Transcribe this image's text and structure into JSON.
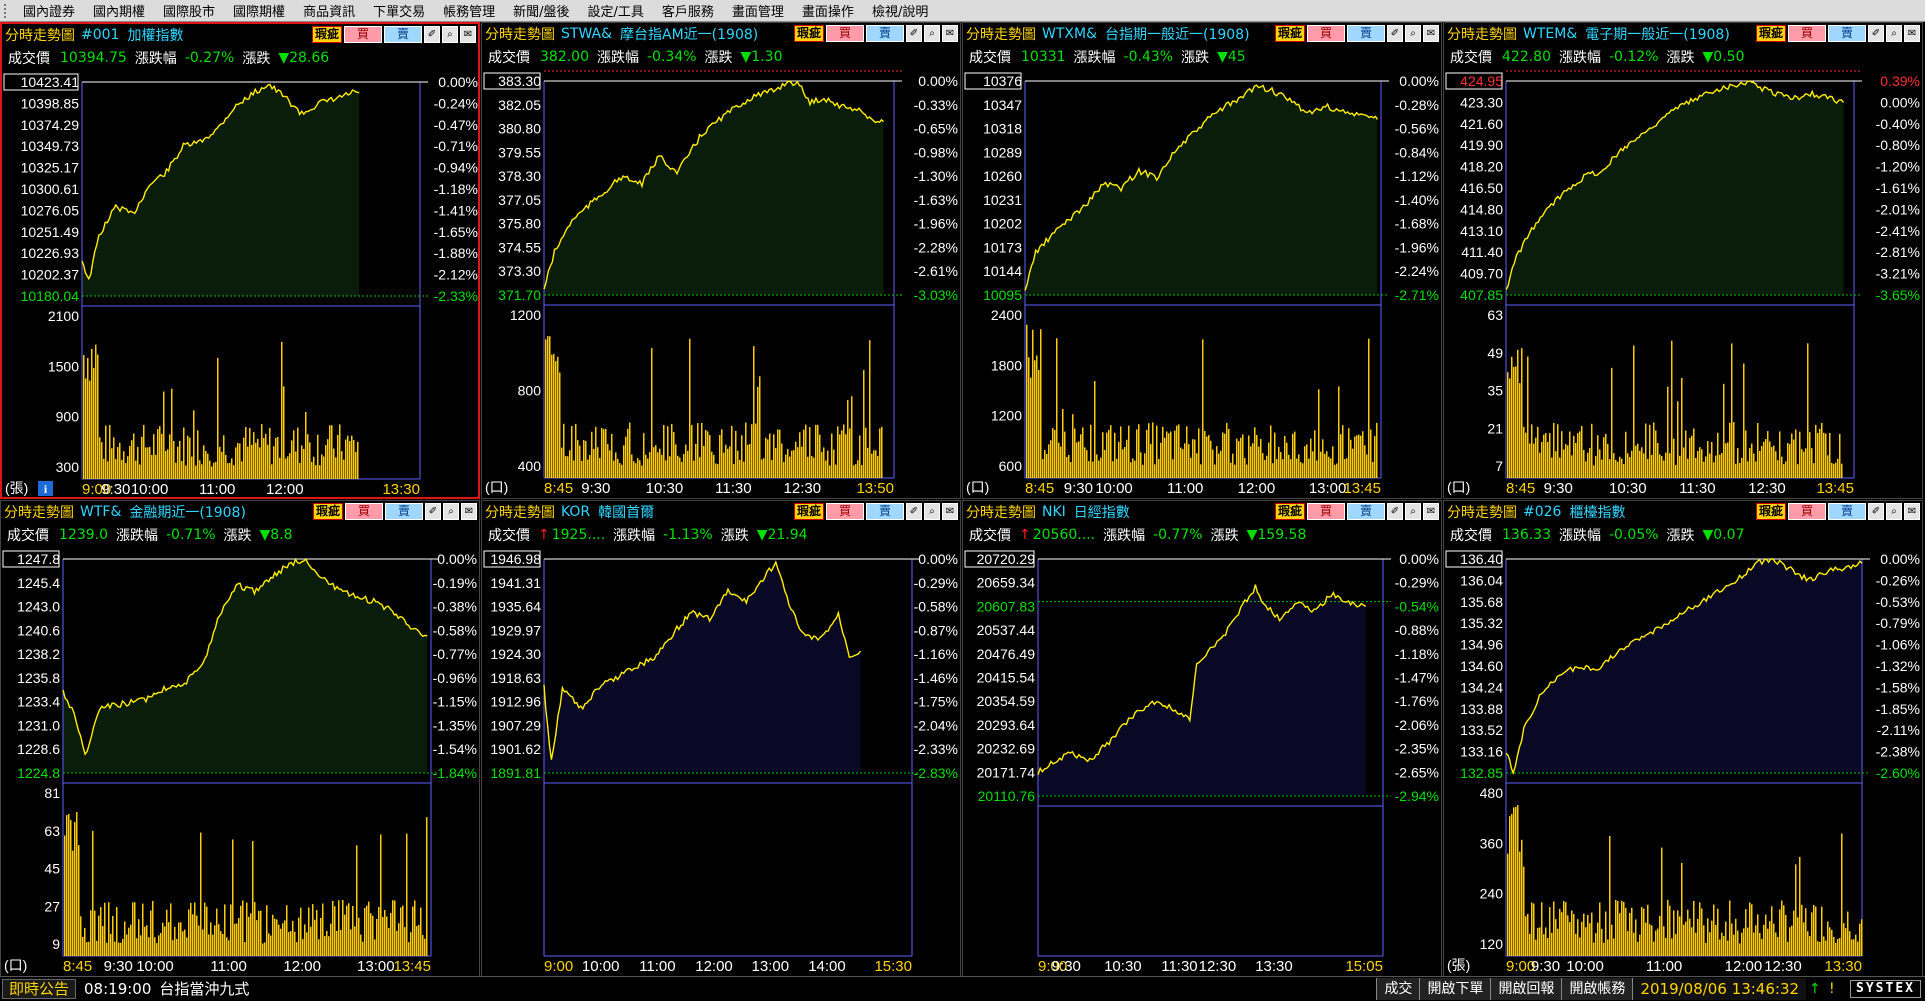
{
  "menu": [
    "國內證券",
    "國內期權",
    "國際股市",
    "國際期權",
    "商品資訊",
    "下單交易",
    "帳務管理",
    "新聞/盤後",
    "設定/工具",
    "客戶服務",
    "畫面管理",
    "畫面操作",
    "檢視/說明"
  ],
  "panel_header": {
    "type_label": "分時走勢圖",
    "btn_hl": "瑕疵",
    "btn_buy": "買",
    "btn_sell": "賣",
    "btn_i1": "✐",
    "btn_i2": "⌕",
    "btn_i3": "✉"
  },
  "quote_labels": {
    "price": "成交價",
    "pct": "漲跌幅",
    "chg": "漲跌"
  },
  "colors": {
    "up": "#ff2020",
    "down": "#00e000",
    "price": "#ffd400",
    "ref": "#ffffff",
    "hi": "#ff2020",
    "lo": "#00e000",
    "volume": "#ffd400"
  },
  "panels": [
    {
      "code": "#001",
      "name": "加權指數",
      "arrow": "",
      "price": "10394.75",
      "pct": "-0.27%",
      "chg": "▼28.66",
      "active": true,
      "price_axis": [
        "10423.41",
        "10398.85",
        "10374.29",
        "10349.73",
        "10325.17",
        "10300.61",
        "10276.05",
        "10251.49",
        "10226.93",
        "10202.37",
        "10180.04"
      ],
      "pct_axis": [
        "0.00%",
        "-0.24%",
        "-0.47%",
        "-0.71%",
        "-0.94%",
        "-1.18%",
        "-1.41%",
        "-1.65%",
        "-1.88%",
        "-2.12%",
        "-2.33%"
      ],
      "vol_axis": [
        "2100",
        "1500",
        "900",
        "300"
      ],
      "vol_unit": "(張)",
      "vol_max": 2100,
      "info_icon": true,
      "time_axis": [
        "9:00",
        "9:30",
        "10:00",
        "11:00",
        "12:00",
        "13:30"
      ],
      "time_frac": [
        0,
        0.1,
        0.2,
        0.4,
        0.6,
        1
      ],
      "profile": [
        [
          0,
          0.83
        ],
        [
          0.02,
          0.93
        ],
        [
          0.05,
          0.72
        ],
        [
          0.1,
          0.58
        ],
        [
          0.15,
          0.62
        ],
        [
          0.2,
          0.48
        ],
        [
          0.25,
          0.42
        ],
        [
          0.3,
          0.3
        ],
        [
          0.35,
          0.28
        ],
        [
          0.4,
          0.22
        ],
        [
          0.45,
          0.12
        ],
        [
          0.5,
          0.06
        ],
        [
          0.55,
          0.01
        ],
        [
          0.6,
          0.07
        ],
        [
          0.65,
          0.15
        ],
        [
          0.7,
          0.1
        ],
        [
          0.75,
          0.08
        ],
        [
          0.8,
          0.05
        ],
        [
          0.82,
          0.05
        ]
      ],
      "end_frac": 0.82,
      "hi_frac": 0.55,
      "ref_frac": 0,
      "mid_line": null,
      "show_mid_label": false,
      "mid_label": ""
    },
    {
      "code": "STWA&",
      "name": "摩台指AM近一(1908)",
      "arrow": "",
      "price": "382.00",
      "pct": "-0.34%",
      "chg": "▼1.30",
      "active": false,
      "price_axis": [
        "383.30",
        "382.05",
        "380.80",
        "379.55",
        "378.30",
        "377.05",
        "375.80",
        "374.55",
        "373.30",
        "371.70"
      ],
      "pct_axis": [
        "0.00%",
        "-0.33%",
        "-0.65%",
        "-0.98%",
        "-1.30%",
        "-1.63%",
        "-1.96%",
        "-2.28%",
        "-2.61%",
        "-3.03%"
      ],
      "vol_axis": [
        "1200",
        "800",
        "400"
      ],
      "vol_unit": "(口)",
      "vol_max": 1400,
      "info_icon": false,
      "time_axis": [
        "8:45",
        "9:30",
        "10:30",
        "11:30",
        "12:30",
        "13:50"
      ],
      "time_frac": [
        0,
        0.148,
        0.344,
        0.541,
        0.738,
        1
      ],
      "profile": [
        [
          0,
          0.97
        ],
        [
          0.03,
          0.8
        ],
        [
          0.08,
          0.65
        ],
        [
          0.15,
          0.55
        ],
        [
          0.22,
          0.45
        ],
        [
          0.28,
          0.48
        ],
        [
          0.33,
          0.35
        ],
        [
          0.38,
          0.43
        ],
        [
          0.45,
          0.25
        ],
        [
          0.5,
          0.18
        ],
        [
          0.55,
          0.12
        ],
        [
          0.6,
          0.07
        ],
        [
          0.65,
          0.05
        ],
        [
          0.7,
          0
        ],
        [
          0.73,
          0.02
        ],
        [
          0.76,
          0.1
        ],
        [
          0.8,
          0.08
        ],
        [
          0.85,
          0.12
        ],
        [
          0.9,
          0.13
        ],
        [
          0.93,
          0.18
        ],
        [
          0.97,
          0.19
        ]
      ],
      "end_frac": 0.97,
      "hi_frac": 0.7,
      "ref_frac": 0.08,
      "mid_line": null,
      "show_mid_label": false,
      "mid_label": ""
    },
    {
      "code": "WTXM&",
      "name": "台指期一般近一(1908)",
      "arrow": "",
      "price": "10331",
      "pct": "-0.43%",
      "chg": "▼45",
      "active": false,
      "price_axis": [
        "10376",
        "10347",
        "10318",
        "10289",
        "10260",
        "10231",
        "10202",
        "10173",
        "10144",
        "10095"
      ],
      "pct_axis": [
        "0.00%",
        "-0.28%",
        "-0.56%",
        "-0.84%",
        "-1.12%",
        "-1.40%",
        "-1.68%",
        "-1.96%",
        "-2.24%",
        "-2.71%"
      ],
      "vol_axis": [
        "2400",
        "1800",
        "1200",
        "600"
      ],
      "vol_unit": "(口)",
      "vol_max": 2600,
      "info_icon": false,
      "time_axis": [
        "8:45",
        "9:30",
        "10:00",
        "11:00",
        "12:00",
        "13:00",
        "13:45"
      ],
      "time_frac": [
        0,
        0.15,
        0.25,
        0.45,
        0.65,
        0.85,
        1
      ],
      "profile": [
        [
          0,
          0.98
        ],
        [
          0.03,
          0.8
        ],
        [
          0.1,
          0.68
        ],
        [
          0.17,
          0.58
        ],
        [
          0.22,
          0.48
        ],
        [
          0.27,
          0.5
        ],
        [
          0.32,
          0.42
        ],
        [
          0.37,
          0.45
        ],
        [
          0.42,
          0.33
        ],
        [
          0.47,
          0.25
        ],
        [
          0.52,
          0.17
        ],
        [
          0.56,
          0.12
        ],
        [
          0.6,
          0.09
        ],
        [
          0.65,
          0.02
        ],
        [
          0.7,
          0.05
        ],
        [
          0.75,
          0.1
        ],
        [
          0.8,
          0.15
        ],
        [
          0.85,
          0.12
        ],
        [
          0.9,
          0.15
        ],
        [
          0.95,
          0.16
        ],
        [
          0.99,
          0.18
        ]
      ],
      "end_frac": 0.99,
      "hi_frac": 0.65,
      "ref_frac": 0.05,
      "mid_line": null,
      "show_mid_label": false,
      "mid_label": ""
    },
    {
      "code": "WTEM&",
      "name": "電子期一般近一(1908)",
      "arrow": "",
      "price": "422.80",
      "pct": "-0.12%",
      "chg": "▼0.50",
      "active": false,
      "price_axis": [
        "424.95",
        "423.30",
        "421.60",
        "419.90",
        "418.20",
        "416.50",
        "414.80",
        "413.10",
        "411.40",
        "409.70",
        "407.85"
      ],
      "pct_axis": [
        "0.39%",
        "0.00%",
        "-0.40%",
        "-0.80%",
        "-1.20%",
        "-1.61%",
        "-2.01%",
        "-2.41%",
        "-2.81%",
        "-3.21%",
        "-3.65%"
      ],
      "vol_axis": [
        "63",
        "49",
        "35",
        "21",
        "7"
      ],
      "vol_unit": "(口)",
      "vol_max": 70,
      "info_icon": false,
      "time_axis": [
        "8:45",
        "9:30",
        "10:30",
        "11:30",
        "12:30",
        "13:45"
      ],
      "time_frac": [
        0,
        0.15,
        0.35,
        0.55,
        0.75,
        1
      ],
      "profile": [
        [
          0,
          0.98
        ],
        [
          0.03,
          0.82
        ],
        [
          0.08,
          0.68
        ],
        [
          0.13,
          0.58
        ],
        [
          0.18,
          0.5
        ],
        [
          0.23,
          0.44
        ],
        [
          0.28,
          0.42
        ],
        [
          0.33,
          0.32
        ],
        [
          0.4,
          0.24
        ],
        [
          0.45,
          0.17
        ],
        [
          0.5,
          0.12
        ],
        [
          0.55,
          0.08
        ],
        [
          0.6,
          0.04
        ],
        [
          0.65,
          0.02
        ],
        [
          0.7,
          0
        ],
        [
          0.73,
          0.03
        ],
        [
          0.78,
          0.06
        ],
        [
          0.83,
          0.08
        ],
        [
          0.88,
          0.06
        ],
        [
          0.93,
          0.08
        ],
        [
          0.97,
          0.1
        ]
      ],
      "end_frac": 0.97,
      "hi_frac": 0.7,
      "ref_frac": 0.087,
      "mid_line": null,
      "show_mid_label": false,
      "mid_label": ""
    },
    {
      "code": "WTF&",
      "name": "金融期近一(1908)",
      "arrow": "",
      "price": "1239.0",
      "pct": "-0.71%",
      "chg": "▼8.8",
      "active": false,
      "price_axis": [
        "1247.8",
        "1245.4",
        "1243.0",
        "1240.6",
        "1238.2",
        "1235.8",
        "1233.4",
        "1231.0",
        "1228.6",
        "1224.8"
      ],
      "pct_axis": [
        "0.00%",
        "-0.19%",
        "-0.38%",
        "-0.58%",
        "-0.77%",
        "-0.96%",
        "-1.15%",
        "-1.35%",
        "-1.54%",
        "-1.84%"
      ],
      "vol_axis": [
        "81",
        "63",
        "45",
        "27",
        "9"
      ],
      "vol_unit": "(口)",
      "vol_max": 90,
      "info_icon": false,
      "time_axis": [
        "8:45",
        "9:30",
        "10:00",
        "11:00",
        "12:00",
        "13:00",
        "13:45"
      ],
      "time_frac": [
        0,
        0.15,
        0.25,
        0.45,
        0.65,
        0.85,
        1
      ],
      "profile": [
        [
          0,
          0.62
        ],
        [
          0.03,
          0.72
        ],
        [
          0.06,
          0.92
        ],
        [
          0.1,
          0.7
        ],
        [
          0.15,
          0.68
        ],
        [
          0.22,
          0.66
        ],
        [
          0.28,
          0.6
        ],
        [
          0.33,
          0.58
        ],
        [
          0.38,
          0.5
        ],
        [
          0.42,
          0.28
        ],
        [
          0.47,
          0.12
        ],
        [
          0.52,
          0.15
        ],
        [
          0.57,
          0.08
        ],
        [
          0.62,
          0.02
        ],
        [
          0.66,
          0
        ],
        [
          0.7,
          0.08
        ],
        [
          0.75,
          0.15
        ],
        [
          0.8,
          0.18
        ],
        [
          0.85,
          0.2
        ],
        [
          0.9,
          0.25
        ],
        [
          0.95,
          0.32
        ],
        [
          0.99,
          0.36
        ]
      ],
      "end_frac": 0.99,
      "hi_frac": 0.66,
      "ref_frac": 0,
      "mid_line": null,
      "show_mid_label": false,
      "mid_label": ""
    },
    {
      "code": "KOR",
      "name": "韓國首爾",
      "arrow": "↑",
      "price": "1925....",
      "pct": "-1.13%",
      "chg": "▼21.94",
      "active": false,
      "price_axis": [
        "1946.98",
        "1941.31",
        "1935.64",
        "1929.97",
        "1924.30",
        "1918.63",
        "1912.96",
        "1907.29",
        "1901.62",
        "1891.81"
      ],
      "pct_axis": [
        "0.00%",
        "-0.29%",
        "-0.58%",
        "-0.87%",
        "-1.16%",
        "-1.46%",
        "-1.75%",
        "-2.04%",
        "-2.33%",
        "-2.83%"
      ],
      "vol_axis": [],
      "vol_unit": "",
      "vol_max": 0,
      "info_icon": false,
      "time_axis": [
        "9:00",
        "10:00",
        "11:00",
        "12:00",
        "13:00",
        "14:00",
        "15:30"
      ],
      "time_frac": [
        0,
        0.154,
        0.308,
        0.462,
        0.615,
        0.769,
        1
      ],
      "profile": [
        [
          0,
          0.6
        ],
        [
          0.02,
          0.95
        ],
        [
          0.05,
          0.6
        ],
        [
          0.1,
          0.7
        ],
        [
          0.15,
          0.6
        ],
        [
          0.2,
          0.55
        ],
        [
          0.25,
          0.5
        ],
        [
          0.3,
          0.46
        ],
        [
          0.35,
          0.35
        ],
        [
          0.4,
          0.25
        ],
        [
          0.45,
          0.28
        ],
        [
          0.5,
          0.15
        ],
        [
          0.55,
          0.2
        ],
        [
          0.6,
          0.08
        ],
        [
          0.63,
          0.02
        ],
        [
          0.66,
          0.18
        ],
        [
          0.7,
          0.35
        ],
        [
          0.75,
          0.38
        ],
        [
          0.8,
          0.26
        ],
        [
          0.83,
          0.45
        ],
        [
          0.86,
          0.43
        ]
      ],
      "end_frac": 0.86,
      "hi_frac": 0.63,
      "ref_frac": 0,
      "mid_line": null,
      "show_mid_label": false,
      "mid_label": ""
    },
    {
      "code": "NKI",
      "name": "日經指數",
      "arrow": "↑",
      "price": "20560....",
      "pct": "-0.77%",
      "chg": "▼159.58",
      "active": false,
      "price_axis": [
        "20720.29",
        "20659.34",
        "20607.83",
        "20537.44",
        "20476.49",
        "20415.54",
        "20354.59",
        "20293.64",
        "20232.69",
        "20171.74",
        "20110.76"
      ],
      "pct_axis": [
        "0.00%",
        "-0.29%",
        "-0.54%",
        "-0.88%",
        "-1.18%",
        "-1.47%",
        "-1.76%",
        "-2.06%",
        "-2.35%",
        "-2.65%",
        "-2.94%"
      ],
      "vol_axis": [],
      "vol_unit": "",
      "vol_max": 0,
      "info_icon": false,
      "time_axis": [
        "9:00",
        "9:30",
        "10:30",
        "11:30",
        "12:30",
        "13:30",
        "15:05"
      ],
      "time_frac": [
        0,
        0.082,
        0.246,
        0.41,
        0.52,
        0.684,
        1
      ],
      "profile": [
        [
          0,
          0.9
        ],
        [
          0.05,
          0.85
        ],
        [
          0.1,
          0.82
        ],
        [
          0.15,
          0.85
        ],
        [
          0.2,
          0.78
        ],
        [
          0.25,
          0.7
        ],
        [
          0.3,
          0.63
        ],
        [
          0.35,
          0.6
        ],
        [
          0.41,
          0.65
        ],
        [
          0.44,
          0.68
        ],
        [
          0.46,
          0.45
        ],
        [
          0.5,
          0.38
        ],
        [
          0.55,
          0.3
        ],
        [
          0.6,
          0.18
        ],
        [
          0.63,
          0.12
        ],
        [
          0.66,
          0.2
        ],
        [
          0.7,
          0.25
        ],
        [
          0.75,
          0.18
        ],
        [
          0.8,
          0.22
        ],
        [
          0.85,
          0.15
        ],
        [
          0.9,
          0.18
        ],
        [
          0.95,
          0.2
        ]
      ],
      "end_frac": 0.95,
      "hi_frac": 0,
      "ref_frac": 0,
      "mid_line": 0.18,
      "show_mid_label": true,
      "mid_label": "20607.83"
    },
    {
      "code": "#026",
      "name": "櫃檯指數",
      "arrow": "",
      "price": "136.33",
      "pct": "-0.05%",
      "chg": "▼0.07",
      "active": false,
      "price_axis": [
        "136.40",
        "136.04",
        "135.68",
        "135.32",
        "134.96",
        "134.60",
        "134.24",
        "133.88",
        "133.52",
        "133.16",
        "132.85"
      ],
      "pct_axis": [
        "0.00%",
        "-0.26%",
        "-0.53%",
        "-0.79%",
        "-1.06%",
        "-1.32%",
        "-1.58%",
        "-1.85%",
        "-2.11%",
        "-2.38%",
        "-2.60%"
      ],
      "vol_axis": [
        "480",
        "360",
        "240",
        "120"
      ],
      "vol_unit": "(張)",
      "vol_max": 500,
      "info_icon": false,
      "time_axis": [
        "9:00",
        "9:30",
        "10:00",
        "11:00",
        "12:00",
        "12:30",
        "13:30"
      ],
      "time_frac": [
        0,
        0.111,
        0.222,
        0.444,
        0.667,
        0.778,
        1
      ],
      "profile": [
        [
          0,
          0.9
        ],
        [
          0.02,
          1
        ],
        [
          0.05,
          0.8
        ],
        [
          0.1,
          0.62
        ],
        [
          0.15,
          0.55
        ],
        [
          0.2,
          0.5
        ],
        [
          0.25,
          0.52
        ],
        [
          0.3,
          0.45
        ],
        [
          0.35,
          0.4
        ],
        [
          0.4,
          0.35
        ],
        [
          0.45,
          0.3
        ],
        [
          0.5,
          0.25
        ],
        [
          0.55,
          0.2
        ],
        [
          0.6,
          0.15
        ],
        [
          0.65,
          0.1
        ],
        [
          0.7,
          0.02
        ],
        [
          0.75,
          0
        ],
        [
          0.8,
          0.05
        ],
        [
          0.85,
          0.1
        ],
        [
          0.9,
          0.06
        ],
        [
          0.95,
          0.04
        ],
        [
          1,
          0.02
        ]
      ],
      "end_frac": 1,
      "hi_frac": 0.75,
      "ref_frac": 0,
      "mid_line": null,
      "show_mid_label": false,
      "mid_label": ""
    }
  ],
  "status": {
    "news_btn": "即時公告",
    "news_time": "08:19:00",
    "news_text": "台指當沖九式",
    "trade": "成交",
    "open_order": "開啟下單",
    "open_report": "開啟回報",
    "open_account": "開啟帳務",
    "clock": "2019/08/06 13:46:32",
    "ind1": "↑",
    "ind2": "!",
    "logo": "SYSTEX"
  }
}
